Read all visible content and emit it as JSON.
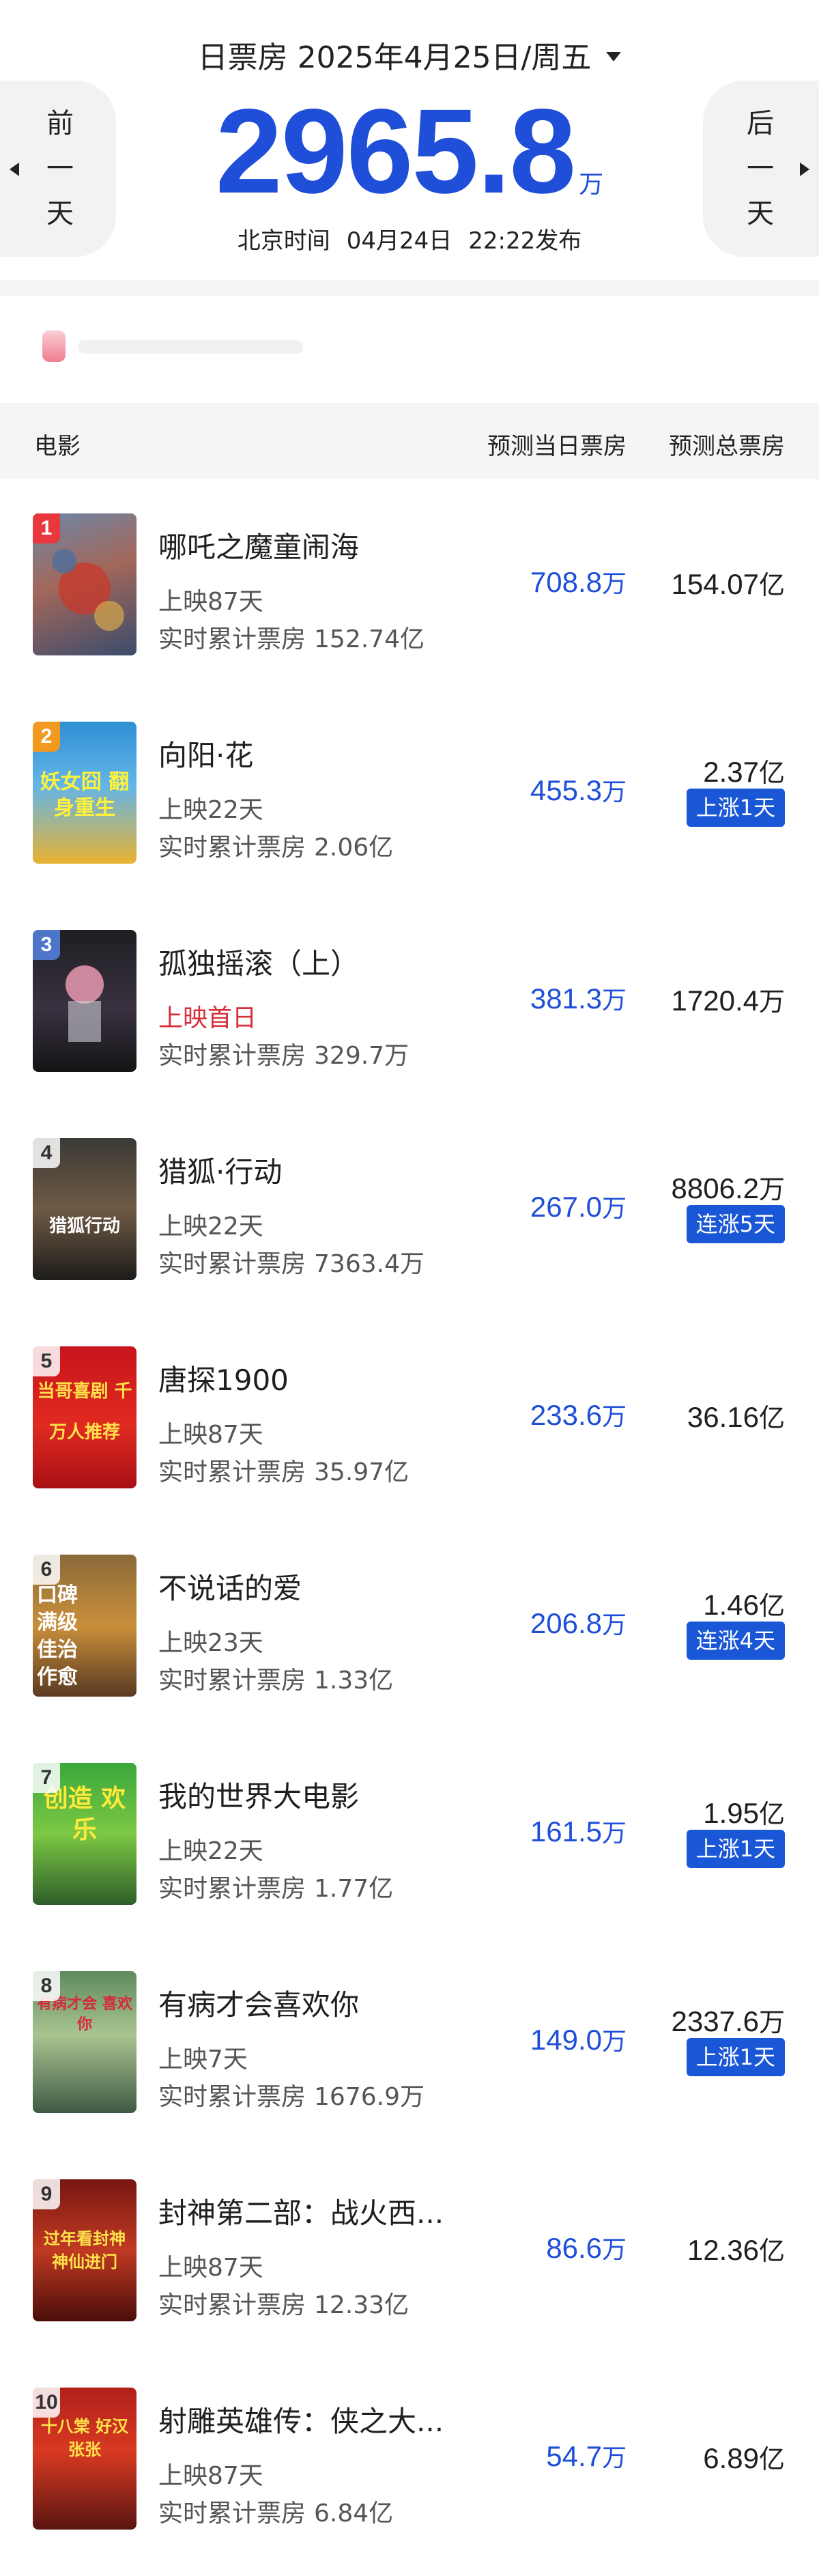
{
  "header": {
    "date_label": "日票房",
    "date_value": "2025年4月25日/周五",
    "prev_label": [
      "前",
      "一",
      "天"
    ],
    "next_label": [
      "后",
      "一",
      "天"
    ],
    "total_value": "2965.8",
    "total_unit": "万",
    "release_prefix": "北京时间",
    "release_date": "04月24日",
    "release_time": "22:22发布"
  },
  "table": {
    "col_movie": "电影",
    "col_today": "预测当日票房",
    "col_total": "预测总票房"
  },
  "movies": [
    {
      "rank": "1",
      "title": "哪吒之魔童闹海",
      "days": "上映87天",
      "cumul_label": "实时累计票房",
      "cumul_value": "152.74亿",
      "today_num": "708.8",
      "today_unit": "万",
      "total_num": "154.07",
      "total_unit": "亿",
      "tag": ""
    },
    {
      "rank": "2",
      "title": "向阳·花",
      "days": "上映22天",
      "cumul_label": "实时累计票房",
      "cumul_value": "2.06亿",
      "today_num": "455.3",
      "today_unit": "万",
      "total_num": "2.37",
      "total_unit": "亿",
      "tag": "上涨1天"
    },
    {
      "rank": "3",
      "title": "孤独摇滚（上）",
      "days": "上映首日",
      "cumul_label": "实时累计票房",
      "cumul_value": "329.7万",
      "today_num": "381.3",
      "today_unit": "万",
      "total_num": "1720.4",
      "total_unit": "万",
      "tag": ""
    },
    {
      "rank": "4",
      "title": "猎狐·行动",
      "days": "上映22天",
      "cumul_label": "实时累计票房",
      "cumul_value": "7363.4万",
      "today_num": "267.0",
      "today_unit": "万",
      "total_num": "8806.2",
      "total_unit": "万",
      "tag": "连涨5天"
    },
    {
      "rank": "5",
      "title": "唐探1900",
      "days": "上映87天",
      "cumul_label": "实时累计票房",
      "cumul_value": "35.97亿",
      "today_num": "233.6",
      "today_unit": "万",
      "total_num": "36.16",
      "total_unit": "亿",
      "tag": ""
    },
    {
      "rank": "6",
      "title": "不说话的爱",
      "days": "上映23天",
      "cumul_label": "实时累计票房",
      "cumul_value": "1.33亿",
      "today_num": "206.8",
      "today_unit": "万",
      "total_num": "1.46",
      "total_unit": "亿",
      "tag": "连涨4天"
    },
    {
      "rank": "7",
      "title": "我的世界大电影",
      "days": "上映22天",
      "cumul_label": "实时累计票房",
      "cumul_value": "1.77亿",
      "today_num": "161.5",
      "today_unit": "万",
      "total_num": "1.95",
      "total_unit": "亿",
      "tag": "上涨1天"
    },
    {
      "rank": "8",
      "title": "有病才会喜欢你",
      "days": "上映7天",
      "cumul_label": "实时累计票房",
      "cumul_value": "1676.9万",
      "today_num": "149.0",
      "today_unit": "万",
      "total_num": "2337.6",
      "total_unit": "万",
      "tag": "上涨1天"
    },
    {
      "rank": "9",
      "title": "封神第二部：战火西...",
      "days": "上映87天",
      "cumul_label": "实时累计票房",
      "cumul_value": "12.33亿",
      "today_num": "86.6",
      "today_unit": "万",
      "total_num": "12.36",
      "total_unit": "亿",
      "tag": ""
    },
    {
      "rank": "10",
      "title": "射雕英雄传：侠之大...",
      "days": "上映87天",
      "cumul_label": "实时累计票房",
      "cumul_value": "6.84亿",
      "today_num": "54.7",
      "today_unit": "万",
      "total_num": "6.89",
      "total_unit": "亿",
      "tag": ""
    }
  ],
  "poster_text": {
    "p2": "妖女囧 翻身重生",
    "p4": "猎狐行动",
    "p5": "当哥喜剧 千万人推荐",
    "p6": "口碑 满级 佳治 作愈",
    "p7": "创造 欢乐",
    "p8": "有病才会 喜欢你",
    "p9": "过年看封神 神仙进门",
    "p10": "十八棠 好汉张张"
  },
  "colors": {
    "accent_blue": "#1f4fd8",
    "tag_blue": "#1a57d6",
    "first_day_red": "#d62f3a"
  }
}
